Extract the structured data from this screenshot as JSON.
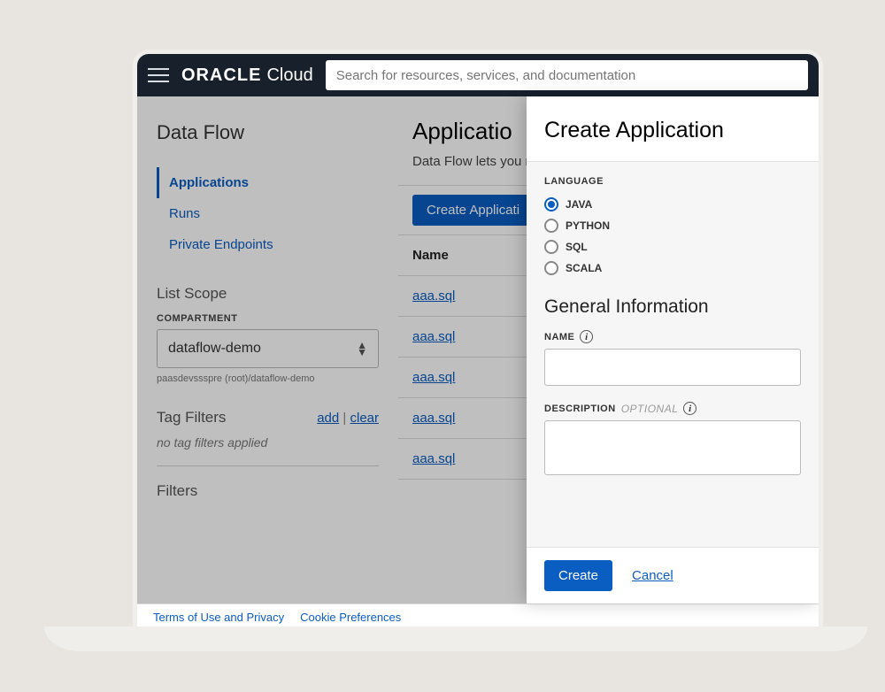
{
  "header": {
    "brand_strong": "ORACLE",
    "brand_light": "Cloud",
    "search_placeholder": "Search for resources, services, and documentation"
  },
  "sidebar": {
    "title": "Data Flow",
    "nav": [
      {
        "label": "Applications",
        "active": true
      },
      {
        "label": "Runs"
      },
      {
        "label": "Private Endpoints"
      }
    ],
    "list_scope_label": "List Scope",
    "compartment_label": "COMPARTMENT",
    "compartment_value": "dataflow-demo",
    "compartment_path": "paasdevssspre (root)/dataflow-demo",
    "tag_filters_label": "Tag Filters",
    "tag_add": "add",
    "tag_clear": "clear",
    "tag_empty": "no tag filters applied",
    "filters_label": "Filters"
  },
  "content": {
    "title": "Applicatio",
    "subtitle": "Data Flow lets you r",
    "create_button": "Create Applicati",
    "name_header": "Name",
    "rows": [
      "aaa.sql",
      "aaa.sql",
      "aaa.sql",
      "aaa.sql",
      "aaa.sql"
    ]
  },
  "drawer": {
    "title": "Create Application",
    "language_label": "LANGUAGE",
    "languages": [
      {
        "label": "JAVA",
        "checked": true
      },
      {
        "label": "PYTHON"
      },
      {
        "label": "SQL"
      },
      {
        "label": "SCALA"
      }
    ],
    "general_heading": "General Information",
    "name_label": "NAME",
    "desc_label": "DESCRIPTION",
    "optional_text": "OPTIONAL",
    "name_value": "",
    "desc_value": "",
    "create_btn": "Create",
    "cancel_btn": "Cancel"
  },
  "footer": {
    "terms": "Terms of Use and Privacy",
    "cookies": "Cookie Preferences"
  }
}
